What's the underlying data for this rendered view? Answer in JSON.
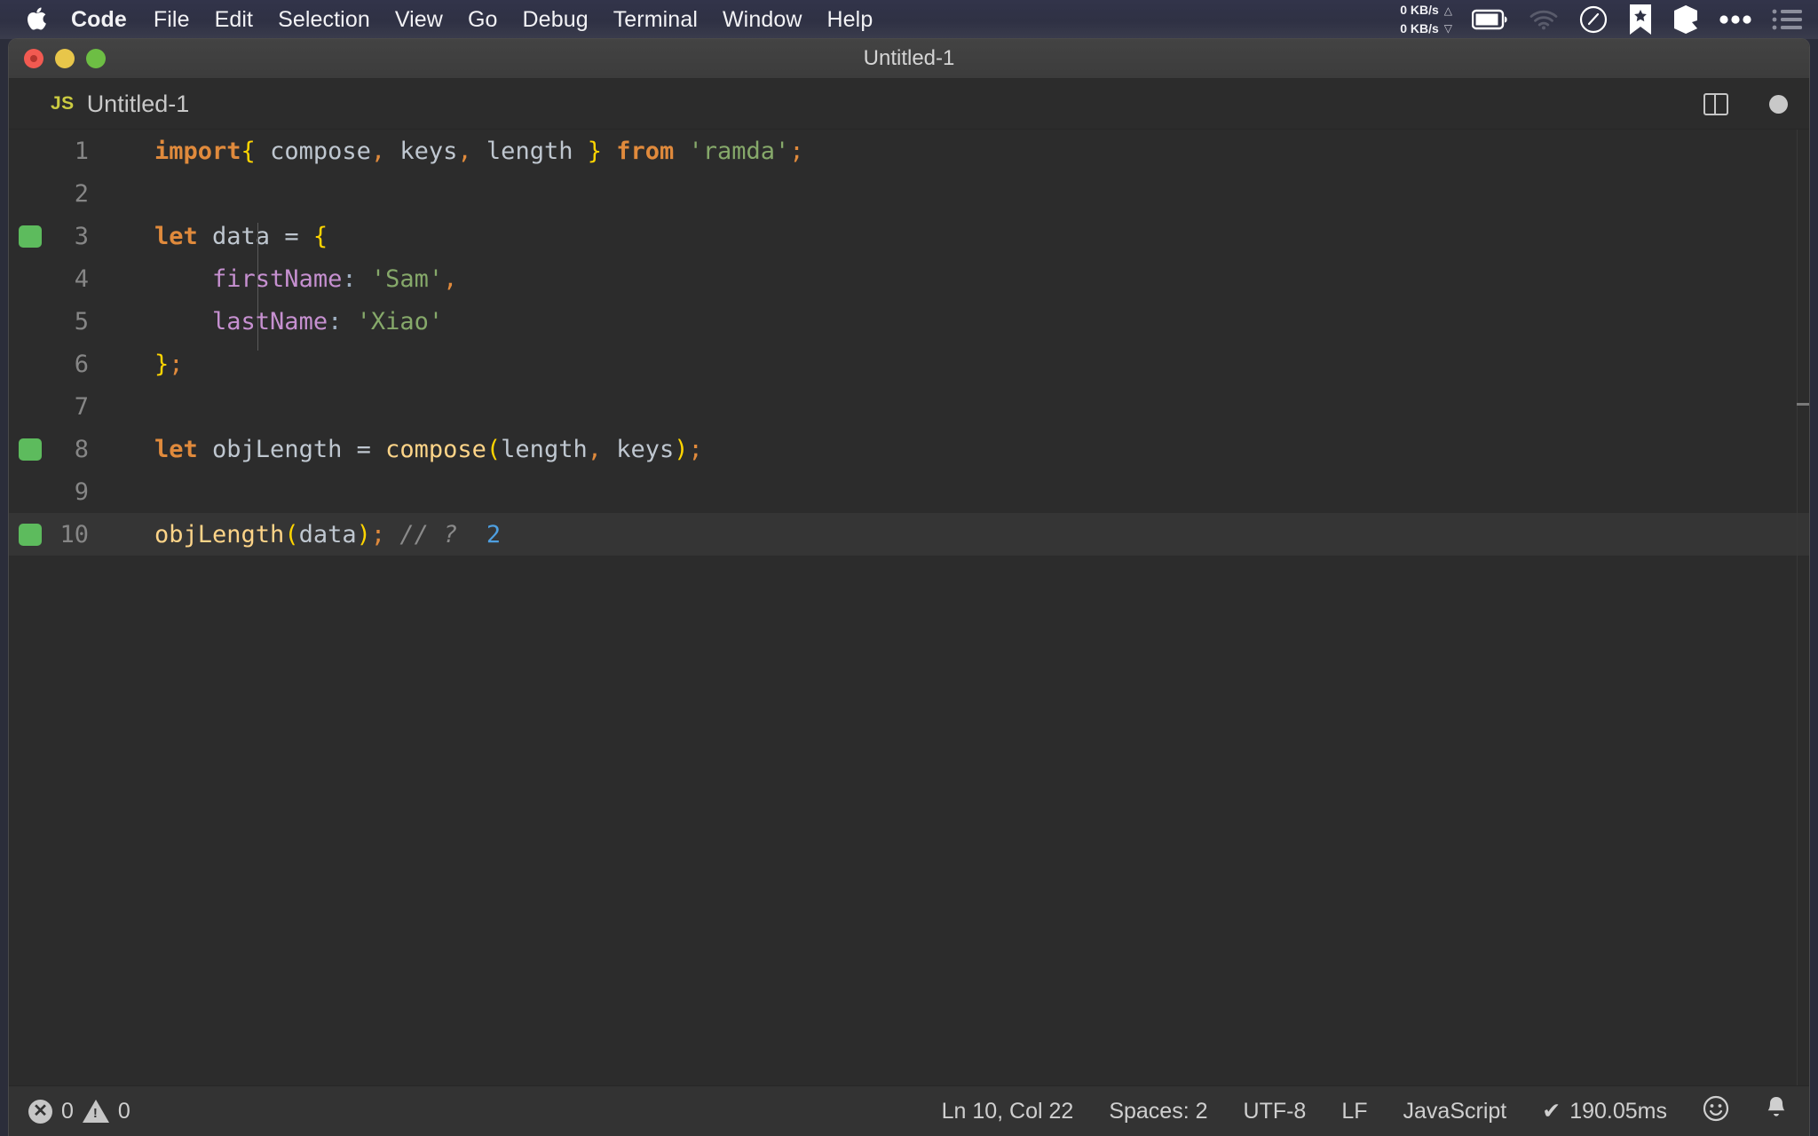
{
  "menubar": {
    "apple_glyph": "",
    "items": [
      {
        "label": "Code",
        "bold": true
      },
      {
        "label": "File",
        "bold": false
      },
      {
        "label": "Edit",
        "bold": false
      },
      {
        "label": "Selection",
        "bold": false
      },
      {
        "label": "View",
        "bold": false
      },
      {
        "label": "Go",
        "bold": false
      },
      {
        "label": "Debug",
        "bold": false
      },
      {
        "label": "Terminal",
        "bold": false
      },
      {
        "label": "Window",
        "bold": false
      },
      {
        "label": "Help",
        "bold": false
      }
    ],
    "network": {
      "upload": "0 KB/s",
      "download": "0 KB/s",
      "up_arrow": "△",
      "down_arrow": "▽"
    },
    "tray_icons": [
      "battery-icon",
      "wifi-icon",
      "gauge-icon",
      "bookmark-star-icon",
      "box-3d-icon",
      "ellipsis-icon",
      "list-icon"
    ]
  },
  "window": {
    "title": "Untitled-1",
    "traffic_lights": [
      "close-button",
      "minimize-button",
      "zoom-button"
    ]
  },
  "tab": {
    "file_type_badge": "JS",
    "label": "Untitled-1",
    "actions": [
      "split-editor-icon",
      "unsaved-dot-icon"
    ]
  },
  "editor": {
    "language": "JavaScript",
    "lines": [
      {
        "no": "1",
        "marker": false,
        "active": false
      },
      {
        "no": "2",
        "marker": false,
        "active": false
      },
      {
        "no": "3",
        "marker": true,
        "active": false
      },
      {
        "no": "4",
        "marker": false,
        "active": false
      },
      {
        "no": "5",
        "marker": false,
        "active": false
      },
      {
        "no": "6",
        "marker": false,
        "active": false
      },
      {
        "no": "7",
        "marker": false,
        "active": false
      },
      {
        "no": "8",
        "marker": true,
        "active": false
      },
      {
        "no": "9",
        "marker": false,
        "active": false
      },
      {
        "no": "10",
        "marker": true,
        "active": true
      }
    ],
    "code": {
      "l1": {
        "kw_import": "import",
        "brace_open": "{",
        "compose": " compose",
        "c1": ",",
        "keys": " keys",
        "c2": ",",
        "length": " length",
        "brace_close": " }",
        "kw_from": " from",
        "str": " 'ramda'",
        "semi": ";"
      },
      "l3": {
        "kw": "let",
        "id": " data ",
        "op": "= ",
        "brace": "{"
      },
      "l4": {
        "prop": "firstName",
        "colon": ":",
        "str": " 'Sam'",
        "comma": ","
      },
      "l5": {
        "prop": "lastName",
        "colon": ":",
        "str": " 'Xiao'"
      },
      "l6": {
        "brace": "}",
        "semi": ";"
      },
      "l8": {
        "kw": "let",
        "id": " objLength ",
        "op": "= ",
        "fn": "compose",
        "paren_open": "(",
        "length": "length",
        "comma": ",",
        "keys": " keys",
        "paren_close": ")",
        "semi": ";"
      },
      "l10": {
        "fn": "objLength",
        "paren_open": "(",
        "arg": "data",
        "paren_close": ")",
        "semi": ";",
        "comment": " // ?",
        "value": "  2"
      }
    }
  },
  "statusbar": {
    "errors": "0",
    "warnings": "0",
    "cursor_position": "Ln 10, Col 22",
    "indentation": "Spaces: 2",
    "encoding": "UTF-8",
    "eol": "LF",
    "language_mode": "JavaScript",
    "quokka_check": "✔",
    "quokka_time": "190.05ms",
    "feedback_icon": "smiley-icon",
    "notifications_icon": "bell-icon"
  },
  "colors": {
    "menubar_bg": "#2f3144",
    "window_bg": "#2c2c2c",
    "statusbar_bg": "#333333",
    "active_line": "#353535",
    "marker_green": "#5dbb5d",
    "js_badge": "#cbcb41",
    "keyword": "#e08a3c",
    "string": "#86a96a",
    "property": "#c690d0",
    "function": "#fdd488",
    "brace": "#ffd500",
    "comment": "#8a8a8a",
    "inline_value": "#4e9fe0"
  }
}
